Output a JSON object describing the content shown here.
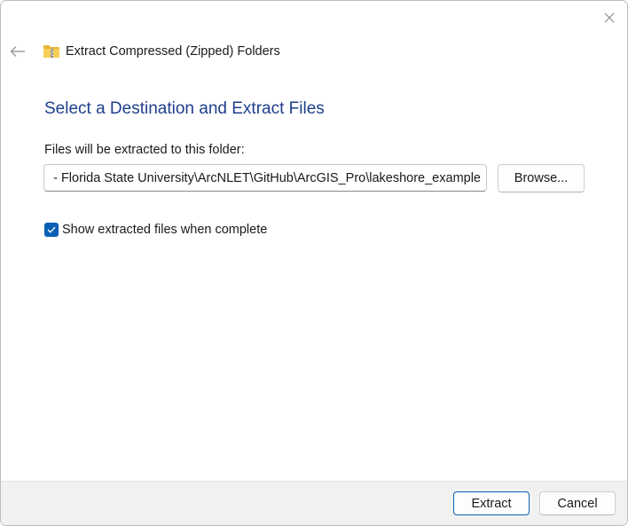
{
  "window": {
    "title": "Extract Compressed (Zipped) Folders"
  },
  "icons": {
    "close": "close-icon",
    "back": "back-arrow-icon",
    "folder": "zipped-folder-icon",
    "check": "checkmark-icon"
  },
  "main": {
    "heading": "Select a Destination and Extract Files",
    "field_label": "Files will be extracted to this folder:",
    "destination_value": "- Florida State University\\ArcNLET\\GitHub\\ArcGIS_Pro\\lakeshore_example",
    "browse_label": "Browse...",
    "show_files_checkbox": {
      "label": "Show extracted files when complete",
      "checked": true
    }
  },
  "footer": {
    "extract_label": "Extract",
    "cancel_label": "Cancel"
  },
  "colors": {
    "heading": "#1e3f8c",
    "accent": "#0b5fb5",
    "footer_bg": "#f1f1f1"
  }
}
